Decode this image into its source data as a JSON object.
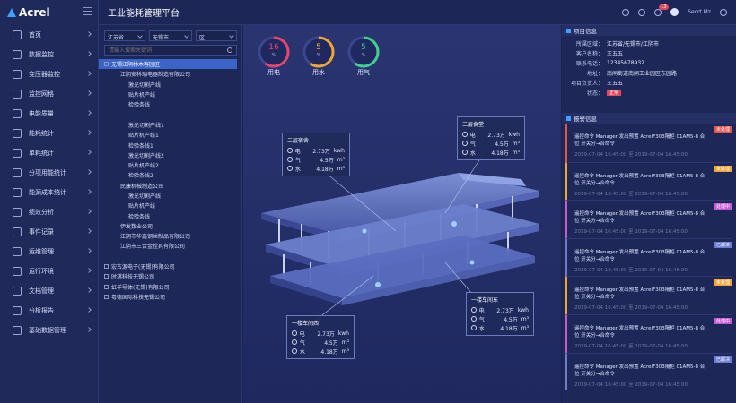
{
  "brand": "Acrel",
  "app_title": "工业能耗管理平台",
  "user": {
    "name": "Secrt Mz",
    "notif_count": "13"
  },
  "nav": [
    {
      "label": "首页",
      "icon": "home-icon"
    },
    {
      "label": "数据监控",
      "icon": "monitor-icon"
    },
    {
      "label": "变压器监控",
      "icon": "transformer-icon"
    },
    {
      "label": "监控网格",
      "icon": "grid-icon"
    },
    {
      "label": "电能质量",
      "icon": "quality-icon"
    },
    {
      "label": "能耗统计",
      "icon": "chart-icon"
    },
    {
      "label": "单耗统计",
      "icon": "unit-icon"
    },
    {
      "label": "分项用能统计",
      "icon": "pin-icon"
    },
    {
      "label": "能源成本统计",
      "icon": "cost-icon"
    },
    {
      "label": "绩效分析",
      "icon": "analysis-icon"
    },
    {
      "label": "事件记录",
      "icon": "event-icon"
    },
    {
      "label": "运维管理",
      "icon": "maintenance-icon"
    },
    {
      "label": "运行环境",
      "icon": "environment-icon"
    },
    {
      "label": "文档管理",
      "icon": "document-icon"
    },
    {
      "label": "分析报告",
      "icon": "report-icon"
    },
    {
      "label": "基础数据管理",
      "icon": "database-icon"
    }
  ],
  "filters": {
    "province": "江苏省",
    "city": "无锡市",
    "district": "区",
    "search_placeholder": "请输入搜索关键词"
  },
  "tree": [
    {
      "label": "无锡江阴林木客园区",
      "indent": 0,
      "selected": true
    },
    {
      "label": "江阴安科瑞电器制造有限公司",
      "indent": 2
    },
    {
      "label": "激光切割产线",
      "indent": 3
    },
    {
      "label": "贴片机产线",
      "indent": 3
    },
    {
      "label": "检验条线",
      "indent": 3
    },
    {
      "label": "",
      "indent": 3
    },
    {
      "label": "激光切割产线1",
      "indent": 3
    },
    {
      "label": "贴片机产线1",
      "indent": 3
    },
    {
      "label": "检验条线1",
      "indent": 3
    },
    {
      "label": "激光切割产线2",
      "indent": 3
    },
    {
      "label": "贴片机产线2",
      "indent": 3
    },
    {
      "label": "检验条线2",
      "indent": 3
    },
    {
      "label": "民康机械制造公司",
      "indent": 2
    },
    {
      "label": "激光切割产线",
      "indent": 3
    },
    {
      "label": "贴片机产线",
      "indent": 3
    },
    {
      "label": "检验条线",
      "indent": 3
    },
    {
      "label": "伊发数业公司",
      "indent": 2
    },
    {
      "label": "江阴市华鑫钢丝制品有限公司",
      "indent": 2
    },
    {
      "label": "江阴市三合金栓具有限公司",
      "indent": 2
    },
    {
      "label": "",
      "indent": 0
    },
    {
      "label": "宏古源电子(无锡)有限公司",
      "indent": 0
    },
    {
      "label": "时琪科技无锡公司",
      "indent": 0
    },
    {
      "label": "虹羊导体(无锡)有限公司",
      "indent": 0
    },
    {
      "label": "粤德国际科技无锡公司",
      "indent": 0
    }
  ],
  "gauges": [
    {
      "value": "16",
      "unit": "%",
      "label": "用电",
      "color": "#e7456d",
      "fraction": 0.16
    },
    {
      "value": "5",
      "unit": "%",
      "label": "用水",
      "color": "#f0a634",
      "fraction": 0.05
    },
    {
      "value": "5",
      "unit": "%",
      "label": "用气",
      "color": "#3fd08e",
      "fraction": 0.05
    }
  ],
  "cards": [
    {
      "title": "二层宿舍",
      "rows": [
        [
          "电",
          "2.73万",
          "kwh"
        ],
        [
          "气",
          "4.5万",
          "m³"
        ],
        [
          "水",
          "4.18万",
          "m³"
        ]
      ]
    },
    {
      "title": "二层食堂",
      "rows": [
        [
          "电",
          "2.73万",
          "kwh"
        ],
        [
          "气",
          "4.5万",
          "m³"
        ],
        [
          "水",
          "4.18万",
          "m³"
        ]
      ]
    },
    {
      "title": "一楼车间西",
      "rows": [
        [
          "电",
          "2.73万",
          "kwh"
        ],
        [
          "气",
          "4.5万",
          "m³"
        ],
        [
          "水",
          "4.18万",
          "m³"
        ]
      ]
    },
    {
      "title": "一楼车间东",
      "rows": [
        [
          "电",
          "2.73万",
          "kwh"
        ],
        [
          "气",
          "4.5万",
          "m³"
        ],
        [
          "水",
          "4.18万",
          "m³"
        ]
      ]
    }
  ],
  "project": {
    "header": "项目信息",
    "rows": [
      {
        "k": "所属区域：",
        "v": "江苏省/无锡市/江阴市"
      },
      {
        "k": "客户名称：",
        "v": "王五五"
      },
      {
        "k": "联系电话：",
        "v": "12345678932"
      },
      {
        "k": "地址：",
        "v": "南闸街道南闸工业园区东园路"
      },
      {
        "k": "项目负责人：",
        "v": "王五五"
      },
      {
        "k": "状态：",
        "v": ""
      }
    ],
    "status": "正常"
  },
  "alarms_header": "报警信息",
  "alarms": [
    {
      "text": "遥控命令 Manager 发出预置 AcrelF303隔柜 01AM5-8 合位 开关分→合命令",
      "time": "2019-07-04 16:45:00 至 2019-07-04 16:45:00",
      "tag": "未处理",
      "color": "#e8534c"
    },
    {
      "text": "遥控命令 Manager 发出预置 AcrelF303隔柜 01AM5-8 合位 开关分→合命令",
      "time": "2019-07-04 16:45:00 至 2019-07-04 16:45:00",
      "tag": "未处理",
      "color": "#f0a634"
    },
    {
      "text": "遥控命令 Manager 发出预置 AcrelF303隔柜 01AM5-8 合位 开关分→合命令",
      "time": "2019-07-04 16:45:00 至 2019-07-04 16:45:00",
      "tag": "处理中",
      "color": "#c45ad6"
    },
    {
      "text": "遥控命令 Manager 发出预置 AcrelF303隔柜 01AM5-8 合位 开关分→合命令",
      "time": "2019-07-04 16:45:00 至 2019-07-04 16:45:00",
      "tag": "已解决",
      "color": "#6b7bd0"
    },
    {
      "text": "遥控命令 Manager 发出预置 AcrelF303隔柜 01AM5-8 合位 开关分→合命令",
      "time": "2019-07-04 16:45:00 至 2019-07-04 16:45:00",
      "tag": "未处理",
      "color": "#f0a634"
    },
    {
      "text": "遥控命令 Manager 发出预置 AcrelF303隔柜 01AM5-8 合位 开关分→合命令",
      "time": "2019-07-04 16:45:00 至 2019-07-04 16:45:00",
      "tag": "处理中",
      "color": "#c45ad6"
    },
    {
      "text": "遥控命令 Manager 发出预置 AcrelF303隔柜 01AM5-8 合位 开关分→合命令",
      "time": "2019-07-04 16:45:00 至 2019-07-04 16:45:00",
      "tag": "已解决",
      "color": "#6b7bd0"
    }
  ]
}
